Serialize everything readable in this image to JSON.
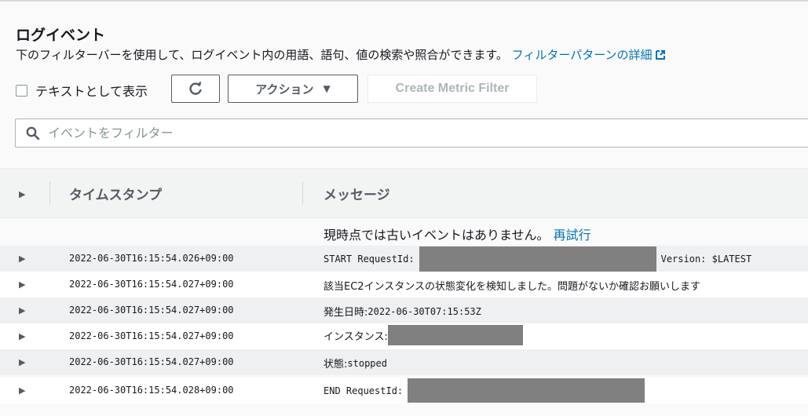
{
  "header": {
    "title": "ログイベント",
    "description": "下のフィルターバーを使用して、ログイベント内の用語、語句、値の検索や照合ができます。",
    "pattern_link": "フィルターパターンの詳細"
  },
  "toolbar": {
    "view_as_text": "テキストとして表示",
    "actions_label": "アクション",
    "create_metric_filter": "Create Metric Filter"
  },
  "search": {
    "placeholder": "イベントをフィルター"
  },
  "table": {
    "col_timestamp": "タイムスタンプ",
    "col_message": "メッセージ",
    "no_older_events": "現時点では古いイベントはありません。",
    "retry_link": "再試行",
    "rows": [
      {
        "timestamp": "2022-06-30T16:15:54.026+09:00",
        "prefix": "START RequestId:",
        "suffix": "Version: $LATEST"
      },
      {
        "timestamp": "2022-06-30T16:15:54.027+09:00",
        "text": "該当EC2インスタンスの状態変化を検知しました。問題がないか確認お願いします"
      },
      {
        "timestamp": "2022-06-30T16:15:54.027+09:00",
        "prefix": "発生日時: ",
        "value": "2022-06-30T07:15:53Z"
      },
      {
        "timestamp": "2022-06-30T16:15:54.027+09:00",
        "prefix": "インスタンス:"
      },
      {
        "timestamp": "2022-06-30T16:15:54.027+09:00",
        "prefix": "状態: ",
        "value": "stopped"
      },
      {
        "timestamp": "2022-06-30T16:15:54.028+09:00",
        "prefix": "END RequestId:"
      }
    ]
  },
  "icons": {
    "external": "external-link-icon",
    "refresh": "refresh-icon",
    "caret": "caret-down-icon",
    "search": "search-icon",
    "expand": "expand-triangle-icon"
  },
  "colors": {
    "link": "#0073bb",
    "redaction": "#808080",
    "alt_row": "#eef0f1"
  }
}
